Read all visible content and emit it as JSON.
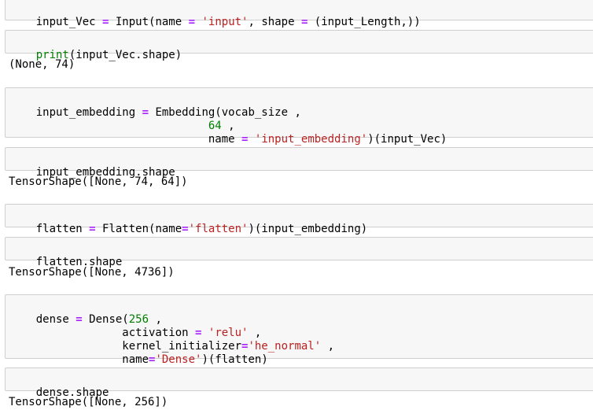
{
  "cells": [
    {
      "lines": [
        [
          "input_Vec ",
          "=",
          " Input(name ",
          "=",
          " ",
          "'input'",
          ", shape ",
          "=",
          " (input_Length,))"
        ]
      ]
    },
    {
      "lines": [
        [
          "print",
          "(input_Vec.shape)"
        ]
      ],
      "output": "(None, 74)"
    },
    {
      "lines": [
        [
          "input_embedding ",
          "=",
          " Embedding(vocab_size ,"
        ],
        [
          "                          ",
          "64",
          " ,"
        ],
        [
          "                          name ",
          "=",
          " ",
          "'input_embedding'",
          ")(input_Vec)"
        ]
      ]
    },
    {
      "lines": [
        [
          "input_embedding.shape"
        ]
      ],
      "output": "TensorShape([None, 74, 64])"
    },
    {
      "lines": [
        [
          "flatten ",
          "=",
          " Flatten(name",
          "=",
          "'flatten'",
          ")(input_embedding)"
        ]
      ]
    },
    {
      "lines": [
        [
          "flatten.shape"
        ]
      ],
      "output": "TensorShape([None, 4736])"
    },
    {
      "lines": [
        [
          "dense ",
          "=",
          " Dense(",
          "256",
          " ,"
        ],
        [
          "             activation ",
          "=",
          " ",
          "'relu'",
          " ,"
        ],
        [
          "             kernel_initializer",
          "=",
          "'he_normal'",
          " ,"
        ],
        [
          "             name",
          "=",
          "'Dense'",
          ")(flatten)"
        ]
      ]
    },
    {
      "lines": [
        [
          "dense.shape"
        ]
      ],
      "output": "TensorShape([None, 256])"
    }
  ]
}
